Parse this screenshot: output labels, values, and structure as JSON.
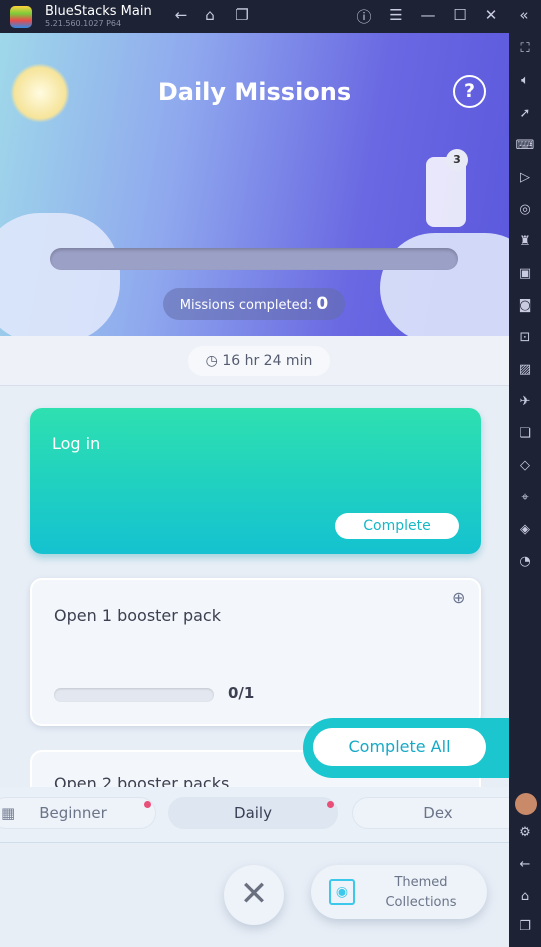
{
  "window": {
    "app_name": "BlueStacks Main",
    "version": "5.21.560.1027  P64"
  },
  "titlebar_icons": [
    "back-icon",
    "home-icon",
    "recent-apps-icon",
    "help-icon",
    "menu-icon",
    "minimize-icon",
    "maximize-icon",
    "close-icon",
    "collapse-sidebar-icon"
  ],
  "hero": {
    "title": "Daily Missions",
    "help": "?",
    "reward_count": "3",
    "missions_label": "Missions completed:",
    "missions_value": "0",
    "progress": 0
  },
  "timer": "16 hr 24 min",
  "missions": [
    {
      "title": "Log in",
      "button": "Complete"
    },
    {
      "title": "Open 1 booster pack",
      "progress": "0/1"
    },
    {
      "title": "Open 2 booster packs"
    }
  ],
  "complete_all": "Complete All",
  "tabs": [
    {
      "label": "Beginner"
    },
    {
      "label": "Daily"
    },
    {
      "label": "Dex"
    }
  ],
  "themed_collections": "Themed Collections",
  "colors": {
    "accent": "#17b7c6",
    "badge": "#e8507a"
  }
}
